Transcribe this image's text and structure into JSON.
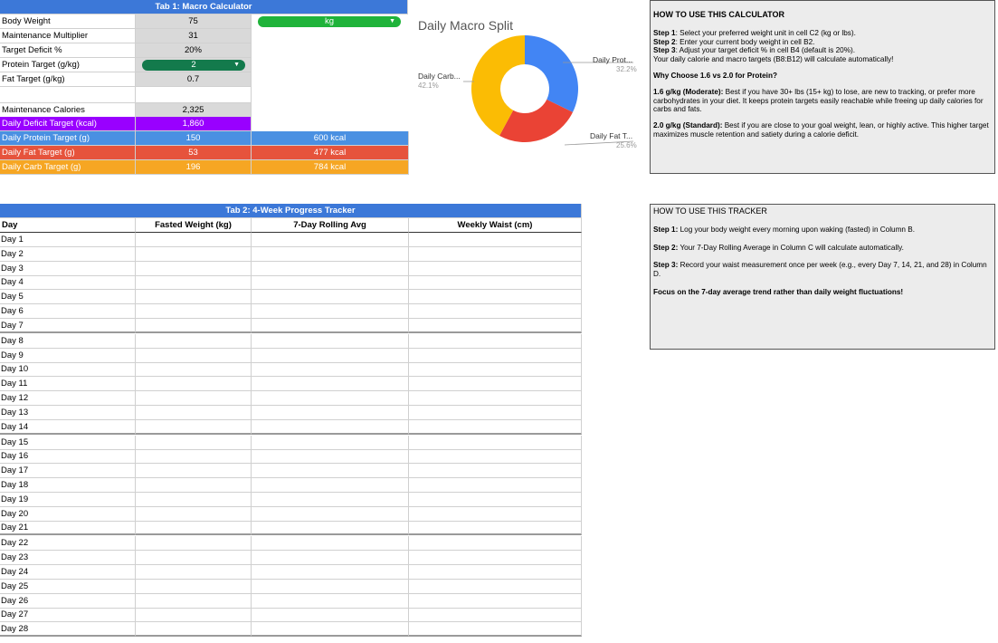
{
  "macro_calculator": {
    "title": "Tab 1: Macro Calculator",
    "inputs": [
      {
        "label": "Body Weight",
        "value": "75"
      },
      {
        "label": "Maintenance Multiplier",
        "value": "31"
      },
      {
        "label": "Target Deficit %",
        "value": "20%"
      },
      {
        "label": "Protein Target (g/kg)",
        "value": "2"
      },
      {
        "label": "Fat Target (g/kg)",
        "value": "0.7"
      }
    ],
    "unit_select": "kg",
    "maintenance": {
      "label": "Maintenance Calories",
      "value": "2,325"
    },
    "targets": [
      {
        "label": "Daily Deficit Target (kcal)",
        "value": "1,860",
        "kcal": ""
      },
      {
        "label": "Daily Protein Target (g)",
        "value": "150",
        "kcal": "600 kcal"
      },
      {
        "label": "Daily Fat Target (g)",
        "value": "53",
        "kcal": "477 kcal"
      },
      {
        "label": "Daily Carb Target (g)",
        "value": "196",
        "kcal": "784 kcal"
      }
    ]
  },
  "chart": {
    "title": "Daily Macro Split",
    "labels": {
      "protein": "Daily Prot...",
      "protein_pct": "32.2%",
      "fat": "Daily Fat T...",
      "fat_pct": "25.6%",
      "carb": "Daily Carb...",
      "carb_pct": "42.1%"
    }
  },
  "chart_data": {
    "type": "pie",
    "title": "Daily Macro Split",
    "categories": [
      "Daily Protein Target (g)",
      "Daily Fat Target (g)",
      "Daily Carb Target (g)"
    ],
    "values": [
      600,
      477,
      784
    ],
    "percent": [
      32.2,
      25.6,
      42.1
    ],
    "colors": [
      "#4285f4",
      "#ea4335",
      "#fbbc04"
    ],
    "donut": true
  },
  "calc_help": {
    "title": "HOW TO USE THIS CALCULATOR",
    "step1_k": "Step 1",
    "step1": ": Select your preferred weight unit in cell C2 (kg or lbs).",
    "step2_k": "Step 2",
    "step2": ": Enter your current body weight in cell B2.",
    "step3_k": "Step 3",
    "step3": ": Adjust your target deficit % in cell B4 (default is 20%).",
    "step4": "Your daily calorie and macro targets (B8:B12) will calculate automatically!",
    "why": "Why Choose 1.6 vs 2.0 for Protein?",
    "mod_k": "1.6 g/kg (Moderate):",
    "mod": " Best if you have 30+ lbs (15+ kg) to lose, are new to tracking, or prefer more carbohydrates in your diet. It keeps protein targets easily reachable while freeing up daily calories for carbs and fats.",
    "std_k": "2.0 g/kg (Standard):",
    "std": " Best if you are close to your goal weight, lean, or highly active. This higher target maximizes muscle retention and satiety during a calorie deficit."
  },
  "tracker": {
    "title": "Tab 2: 4-Week Progress Tracker",
    "headers": [
      "Day",
      "Fasted Weight (kg)",
      "7-Day Rolling Avg",
      "Weekly Waist (cm)"
    ],
    "days": [
      "Day 1",
      "Day 2",
      "Day 3",
      "Day 4",
      "Day 5",
      "Day 6",
      "Day 7",
      "Day 8",
      "Day 9",
      "Day 10",
      "Day 11",
      "Day 12",
      "Day 13",
      "Day 14",
      "Day 15",
      "Day 16",
      "Day 17",
      "Day 18",
      "Day 19",
      "Day 20",
      "Day 21",
      "Day 22",
      "Day 23",
      "Day 24",
      "Day 25",
      "Day 26",
      "Day 27",
      "Day 28"
    ]
  },
  "tracker_help": {
    "title": "HOW TO USE THIS TRACKER",
    "s1_k": "Step 1:",
    "s1": " Log your body weight every morning upon waking (fasted) in Column B.",
    "s2_k": "Step 2:",
    "s2": " Your 7-Day Rolling Average in Column C will calculate automatically.",
    "s3_k": "Step 3:",
    "s3": " Record your waist measurement once per week (e.g., every Day 7, 14, 21, and 28) in Column D.",
    "focus": "Focus on the 7-day average trend rather than daily weight fluctuations!"
  },
  "colors": {
    "header_blue": "#3c78d8",
    "purple": "#9900ff",
    "blue": "#4a90e2",
    "red": "#e6533c",
    "orange": "#f6a623",
    "green_chip": "#1fb33a",
    "dark_green_chip": "#137a4c"
  }
}
